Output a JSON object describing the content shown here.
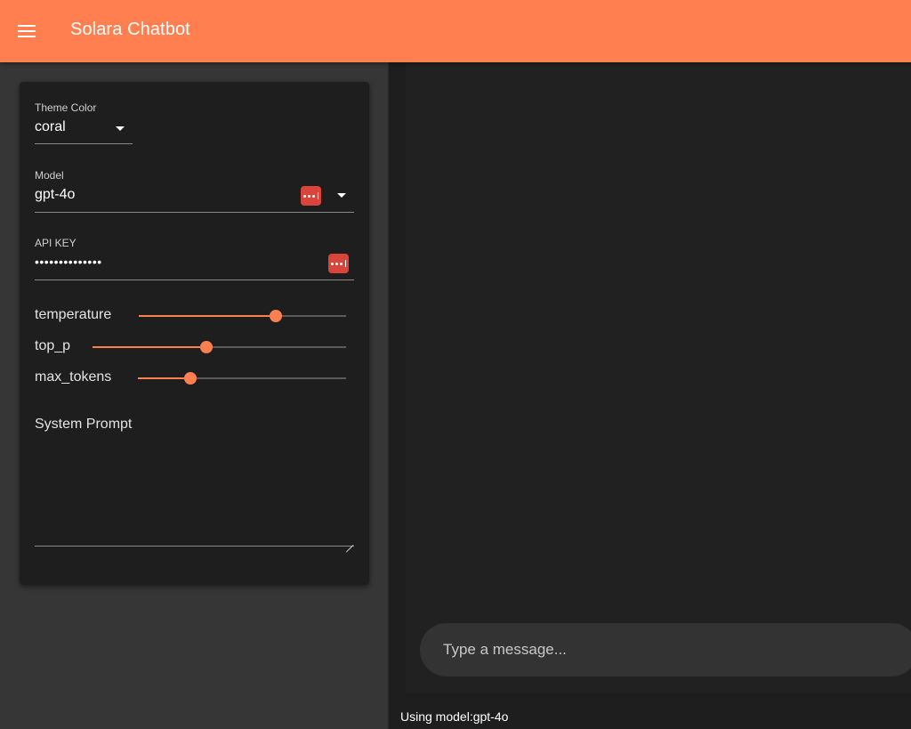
{
  "app": {
    "title": "Solara Chatbot",
    "accent_color": "#ff7f50",
    "menu_icon": "menu-icon"
  },
  "sidebar": {
    "theme_color": {
      "label": "Theme Color",
      "value": "coral"
    },
    "model": {
      "label": "Model",
      "value": "gpt-4o"
    },
    "api_key": {
      "label": "API KEY",
      "value": "••••••••••••••"
    },
    "sliders": [
      {
        "label": "temperature",
        "value_fraction": 0.66
      },
      {
        "label": "top_p",
        "value_fraction": 0.45
      },
      {
        "label": "max_tokens",
        "value_fraction": 0.25
      }
    ],
    "system_prompt": {
      "label": "System Prompt",
      "value": ""
    }
  },
  "main": {
    "message_placeholder": "Type a message...",
    "status": "Using model:gpt-4o"
  }
}
